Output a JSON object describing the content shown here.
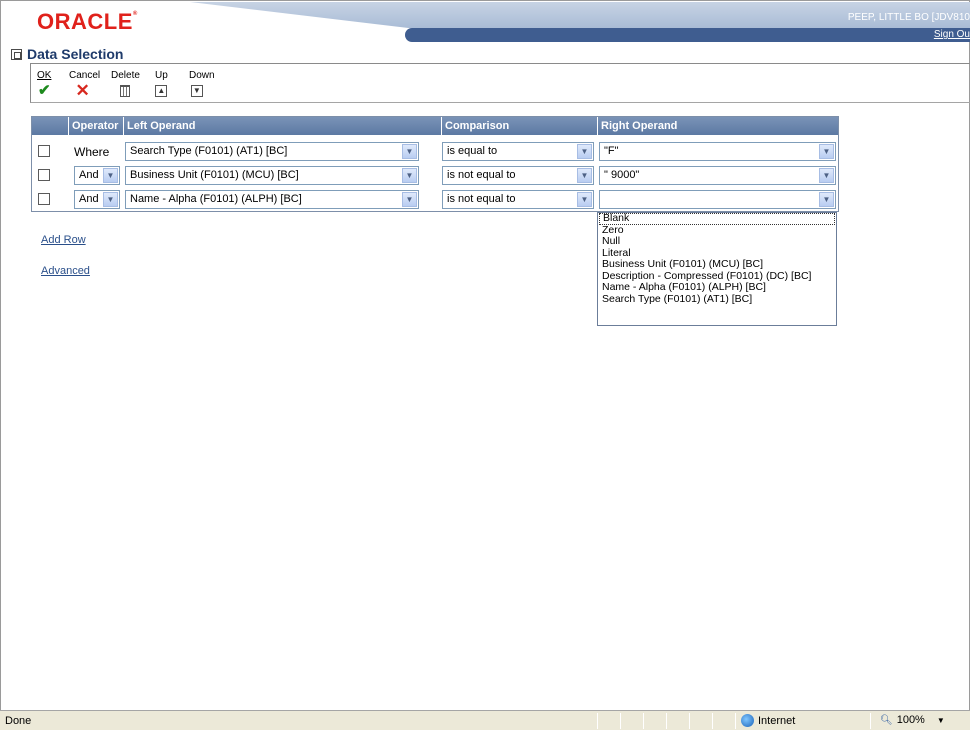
{
  "header": {
    "logo": "ORACLE",
    "user": "PEEP, LITTLE BO  [JDV810",
    "sign_out": "Sign Ou"
  },
  "page": {
    "title": "Data Selection"
  },
  "toolbar": {
    "ok": "OK",
    "cancel": "Cancel",
    "delete": "Delete",
    "up": "Up",
    "down": "Down"
  },
  "grid": {
    "headers": [
      "Operator",
      "Left Operand",
      "Comparison",
      "Right Operand"
    ],
    "rows": [
      {
        "operator": "Where",
        "left": "Search Type (F0101) (AT1) [BC]",
        "comparison": "is equal to",
        "right": "\"F\""
      },
      {
        "operator": "And",
        "left": "Business Unit (F0101) (MCU) [BC]",
        "comparison": "is not equal to",
        "right": "\" 9000\""
      },
      {
        "operator": "And",
        "left": "Name - Alpha (F0101) (ALPH) [BC]",
        "comparison": "is not equal to",
        "right": ""
      }
    ]
  },
  "links": {
    "add_row": "Add Row",
    "advanced": "Advanced"
  },
  "dropdown": {
    "items": [
      "Blank",
      "Zero",
      "Null",
      "Literal",
      "Business Unit (F0101) (MCU) [BC]",
      "Description - Compressed (F0101) (DC) [BC]",
      "Name - Alpha (F0101) (ALPH) [BC]",
      "Search Type (F0101) (AT1) [BC]"
    ]
  },
  "statusbar": {
    "status": "Done",
    "zone": "Internet",
    "zoom": "100%"
  },
  "icons": {
    "ok": "checkmark-icon",
    "cancel": "x-icon",
    "delete": "trash-icon",
    "up": "chevron-up-icon",
    "down": "chevron-down-icon"
  },
  "colors": {
    "logo": "#e0211b",
    "header_band": "#3f5d90",
    "grid_header": "#5c79a3",
    "title": "#1f3b6b"
  }
}
